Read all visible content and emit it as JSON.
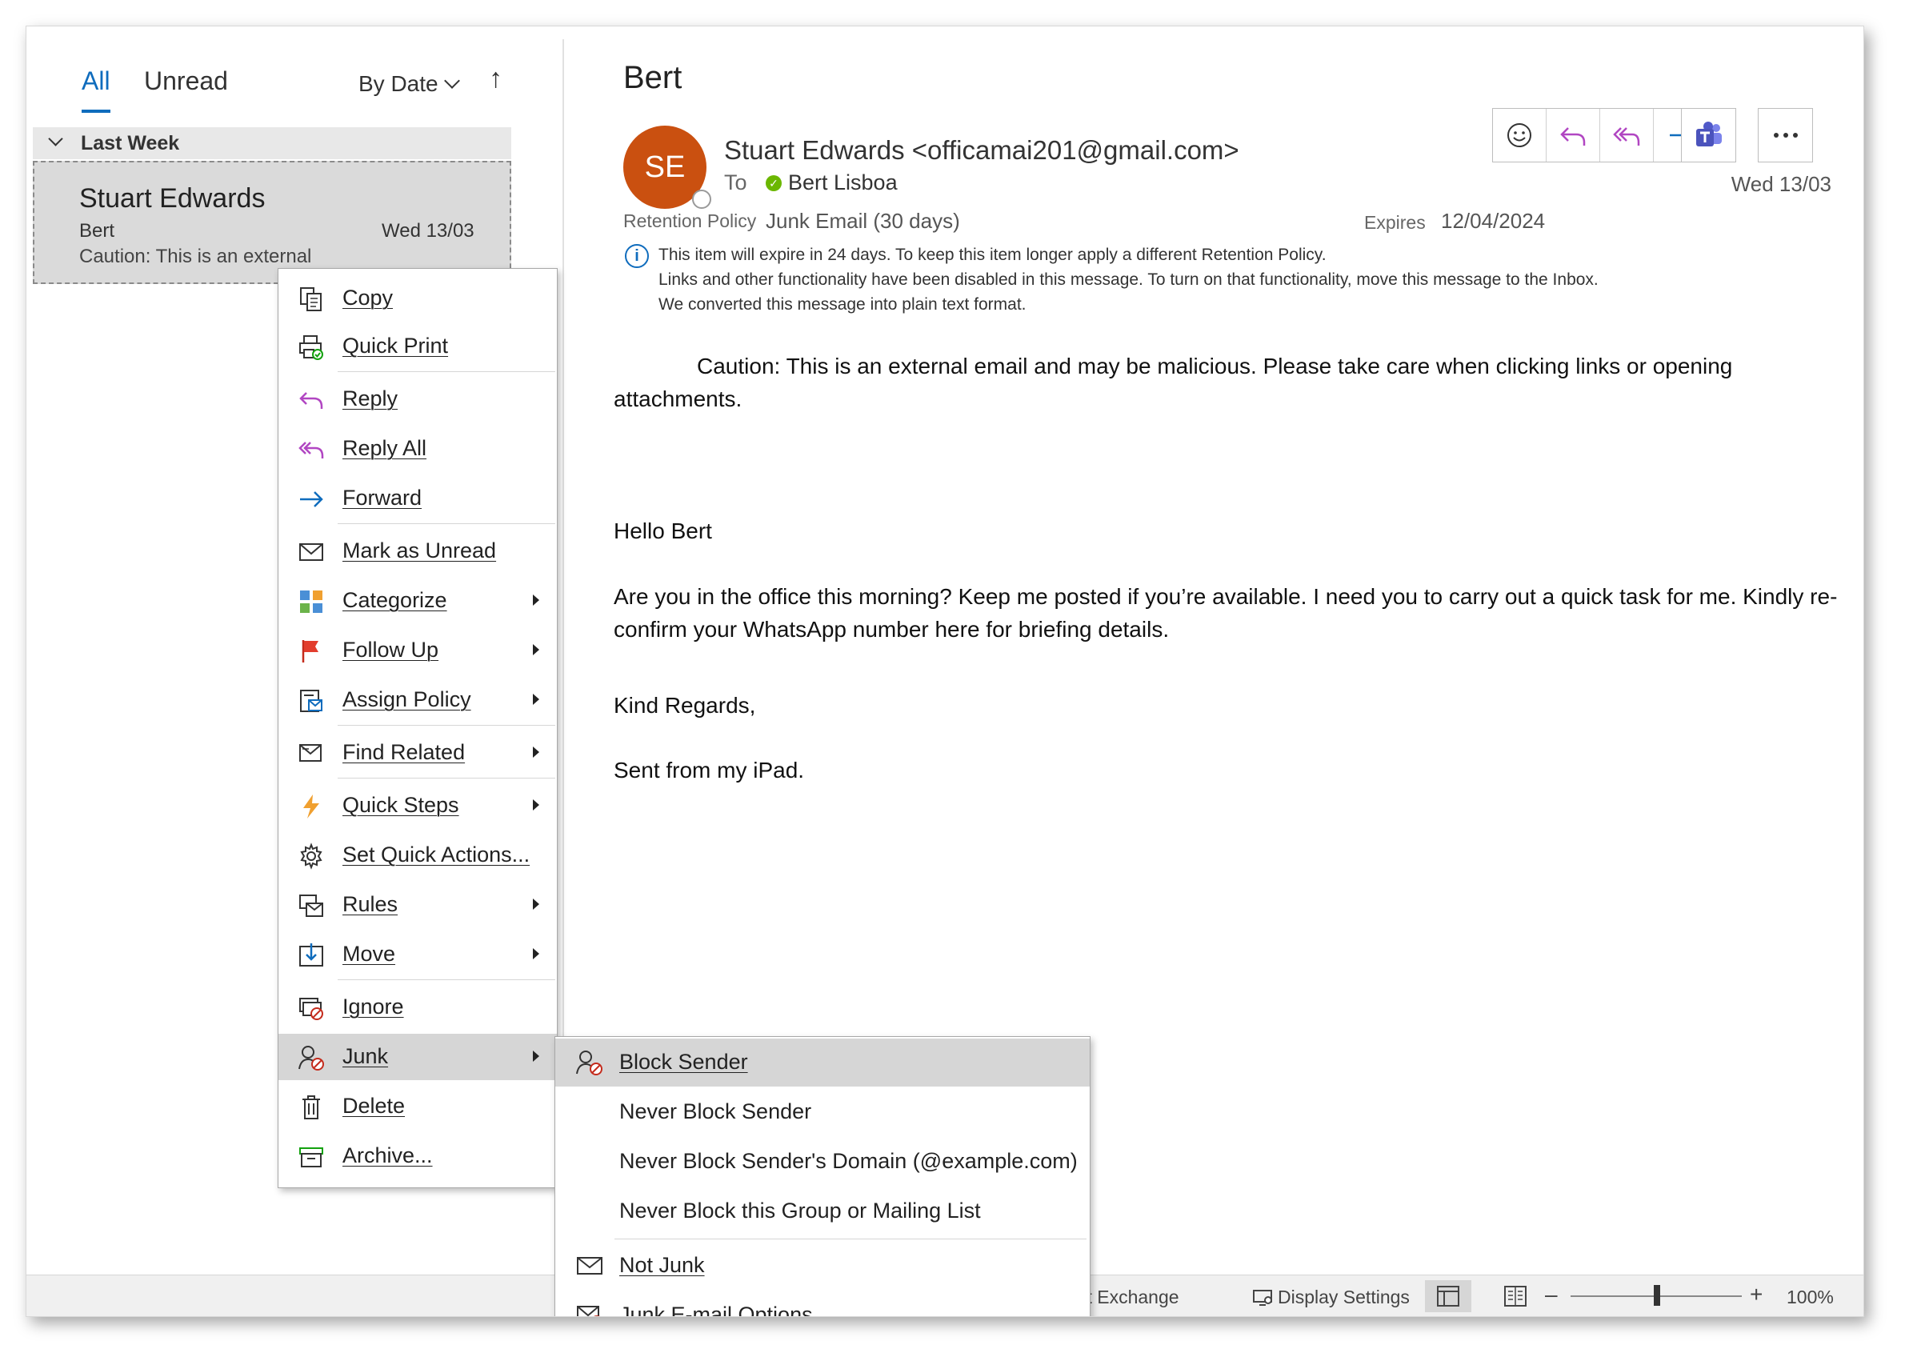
{
  "list": {
    "tabs": [
      {
        "label": "All"
      },
      {
        "label": "Unread"
      }
    ],
    "sort_label": "By Date",
    "group_label": "Last Week",
    "item": {
      "from": "Stuart Edwards",
      "subject": "Bert",
      "date": "Wed 13/03",
      "preview": "Caution: This is an external"
    }
  },
  "message": {
    "subject": "Bert",
    "avatar_initials": "SE",
    "avatar_color": "#ca5010",
    "sender": "Stuart Edwards <officamai201@gmail.com>",
    "to_label": "To",
    "to_name": "Bert Lisboa",
    "date": "Wed 13/03",
    "retention_label": "Retention Policy",
    "retention_value": "Junk Email (30 days)",
    "expires_label": "Expires",
    "expires_value": "12/04/2024",
    "info_lines": [
      "This item will expire in 24 days. To keep this item longer apply a different Retention Policy.",
      "Links and other functionality have been disabled in this message. To turn on that functionality, move this message to the Inbox.",
      "We converted this message into plain text format."
    ],
    "body": {
      "caution": "Caution: This is an external email and may be malicious. Please take care when clicking links or opening attachments.",
      "greeting": "Hello Bert",
      "paragraph": "Are you in the office this morning? Keep me posted if you’re available. I need you to carry out a quick task for me. Kindly re-confirm your WhatsApp number here for briefing details.",
      "regards": "Kind Regards,",
      "signature": "Sent from my iPad."
    }
  },
  "toolbar": {
    "icons": [
      "emoji-icon",
      "reply-icon",
      "reply-all-icon",
      "forward-icon",
      "teams-icon",
      "more-icon"
    ],
    "accent_color": "#0f6cbd",
    "reply_color": "#b146c2"
  },
  "context_menu": {
    "items": [
      {
        "label": "Copy",
        "icon": "copy-icon",
        "submenu": false
      },
      {
        "label": "Quick Print",
        "icon": "quick-print-icon",
        "submenu": false
      },
      {
        "label": "Reply",
        "icon": "reply-icon",
        "submenu": false
      },
      {
        "label": "Reply All",
        "icon": "reply-all-icon",
        "submenu": false
      },
      {
        "label": "Forward",
        "icon": "forward-icon",
        "submenu": false
      },
      {
        "label": "Mark as Unread",
        "icon": "envelope-icon",
        "submenu": false
      },
      {
        "label": "Categorize",
        "icon": "categorize-icon",
        "submenu": true
      },
      {
        "label": "Follow Up",
        "icon": "flag-icon",
        "submenu": true
      },
      {
        "label": "Assign Policy",
        "icon": "assign-policy-icon",
        "submenu": true
      },
      {
        "label": "Find Related",
        "icon": "find-related-icon",
        "submenu": true
      },
      {
        "label": "Quick Steps",
        "icon": "lightning-icon",
        "submenu": true
      },
      {
        "label": "Set Quick Actions...",
        "icon": "gear-icon",
        "submenu": false
      },
      {
        "label": "Rules",
        "icon": "rules-icon",
        "submenu": true
      },
      {
        "label": "Move",
        "icon": "move-icon",
        "submenu": true
      },
      {
        "label": "Ignore",
        "icon": "ignore-icon",
        "submenu": false
      },
      {
        "label": "Junk",
        "icon": "junk-icon",
        "submenu": true,
        "highlighted": true
      },
      {
        "label": "Delete",
        "icon": "trash-icon",
        "submenu": false
      },
      {
        "label": "Archive...",
        "icon": "archive-icon",
        "submenu": false
      }
    ]
  },
  "junk_submenu": {
    "items": [
      {
        "label": "Block Sender",
        "icon": "block-sender-icon",
        "highlighted": true
      },
      {
        "label": "Never Block Sender"
      },
      {
        "label": "Never Block Sender's Domain (@example.com)"
      },
      {
        "label": "Never Block this Group or Mailing List"
      },
      {
        "label": "Not Junk",
        "icon": "envelope-icon"
      },
      {
        "label": "Junk E-mail Options...",
        "icon": "junk-options-icon"
      }
    ]
  },
  "statusbar": {
    "exchange_text": "osoft Exchange",
    "display_settings": "Display Settings",
    "zoom_minus": "–",
    "zoom_plus": "+",
    "zoom": "100%"
  }
}
